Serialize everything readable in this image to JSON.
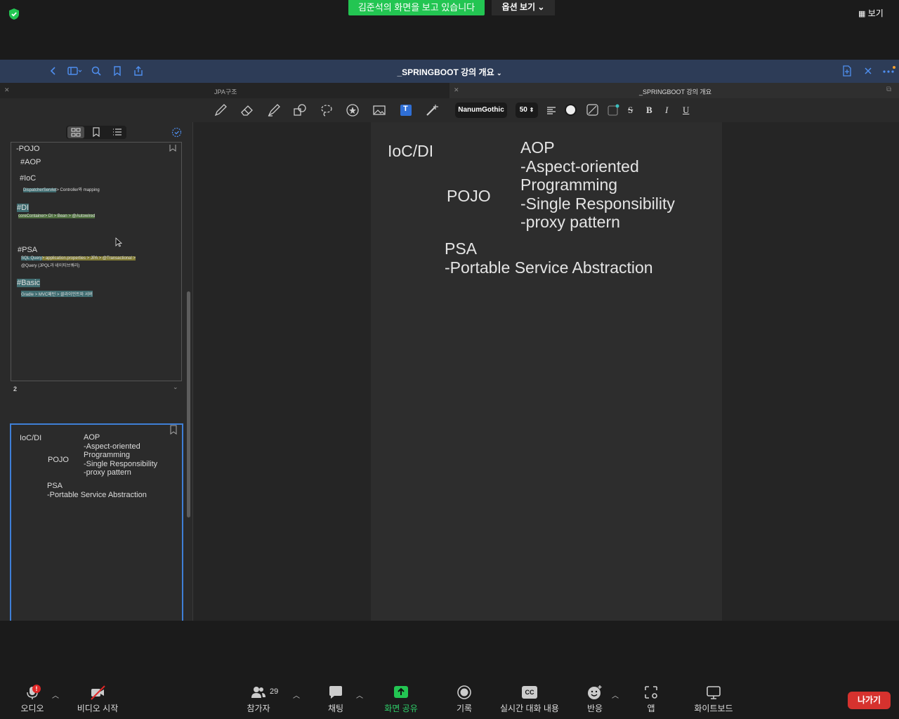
{
  "zoom": {
    "share_banner": "김준석의 화면을 보고 있습니다",
    "view_options": "옵션 보기",
    "view_button": "보기",
    "controls": {
      "audio": "오디오",
      "video": "비디오 시작",
      "participants": "참가자",
      "participants_count": "29",
      "chat": "채팅",
      "share": "화면 공유",
      "record": "기록",
      "captions": "실시간 대화 내용",
      "captions_icon_text": "CC",
      "reactions": "반응",
      "apps": "앱",
      "whiteboard": "화이트보드",
      "leave": "나가기"
    }
  },
  "app": {
    "doc_title": "_SPRINGBOOT 강의 개요",
    "tabs": [
      {
        "label": "JPA구조"
      },
      {
        "label": "_SPRINGBOOT 강의 개요"
      }
    ],
    "font_name": "NanumGothic",
    "font_size": "50",
    "format_labels": {
      "strike": "S",
      "bold": "B",
      "italic": "I",
      "underline": "U",
      "text_tool": "T"
    }
  },
  "sidebar": {
    "page2_label": "2",
    "thumb1": {
      "lines": [
        "-POJO",
        "#AOP",
        "#IoC",
        "DispatcherServlet",
        "> Controller와 mapping",
        "#DI",
        "coreContainer",
        "> DI > Bean > @Autowired",
        "#PSA",
        "SQL Query",
        "> application.properties > JPA > @Transactional >",
        "@Query (JPQL과 네이티브쿼리)",
        "#Basic",
        "Gradle > MVC패턴 > 클라이언트와 서버"
      ]
    },
    "thumb2": {
      "ioc": "IoC/DI",
      "aop": "AOP",
      "aop1": "-Aspect-oriented",
      "aop2": "Programming",
      "aop3": "-Single Responsibility",
      "aop4": "-proxy pattern",
      "pojo": "POJO",
      "psa": "PSA",
      "psa1": "-Portable Service Abstraction"
    }
  },
  "page": {
    "ioc": "IoC/DI",
    "aop": "AOP",
    "aop1": "-Aspect-oriented",
    "aop2": "Programming",
    "aop3": "-Single Responsibility",
    "aop4": "-proxy pattern",
    "pojo": "POJO",
    "psa": "PSA",
    "psa1": "-Portable Service Abstraction"
  },
  "colors": {
    "share_green": "#23c552",
    "app_bar": "#2d3c57",
    "selection_blue": "#3f7fd6",
    "leave_red": "#d6322e"
  }
}
